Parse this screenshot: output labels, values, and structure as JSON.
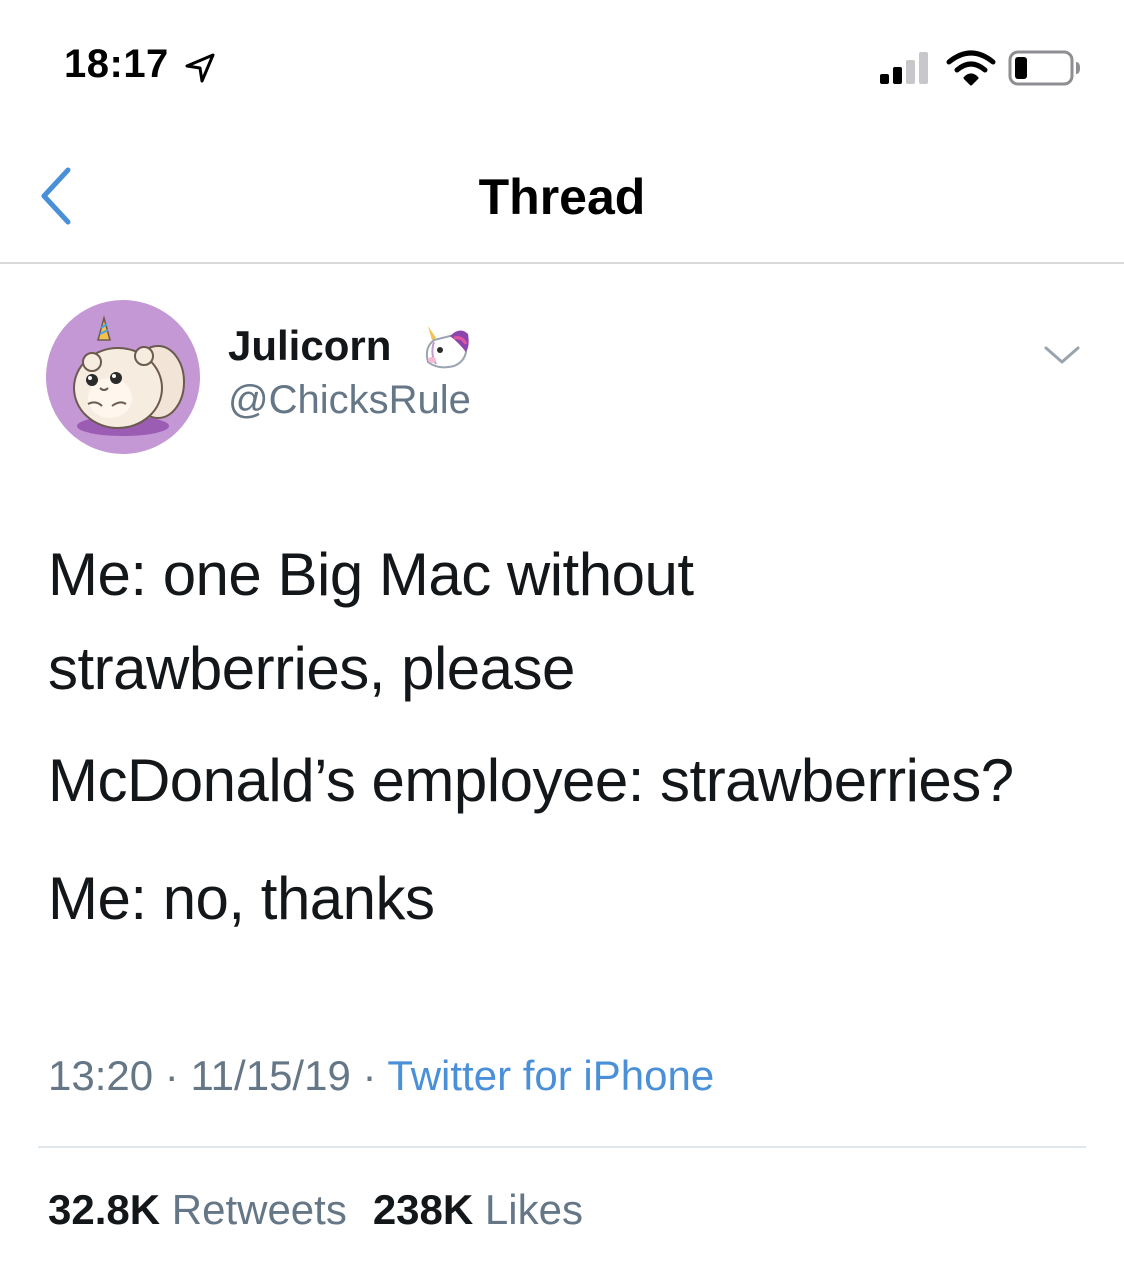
{
  "status_bar": {
    "time": "18:17",
    "location_icon": "location-arrow-icon",
    "signal_icon": "cellular-signal-icon",
    "wifi_icon": "wifi-icon",
    "battery_icon": "battery-icon"
  },
  "nav": {
    "back_icon": "chevron-left-icon",
    "title": "Thread"
  },
  "tweet": {
    "author": {
      "display_name": "Julicorn",
      "handle": "@ChicksRule",
      "name_emoji": "unicorn-icon",
      "avatar_color": "#c497d5"
    },
    "menu_icon": "chevron-down-icon",
    "lines": [
      "Me: one Big Mac without",
      "strawberries, please",
      "McDonald’s employee: strawberries?",
      "Me: no, thanks"
    ],
    "meta": {
      "time": "13:20",
      "separator": " · ",
      "date": "11/15/19",
      "source": "Twitter for iPhone"
    },
    "stats": {
      "retweets_count": "32.8K",
      "retweets_label": "Retweets",
      "likes_count": "238K",
      "likes_label": "Likes"
    }
  },
  "colors": {
    "link_blue": "#4a90d9",
    "secondary_text": "#657786",
    "primary_text": "#14171a"
  }
}
